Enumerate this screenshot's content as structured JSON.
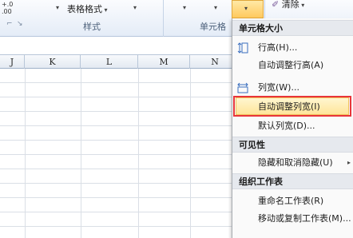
{
  "ribbon": {
    "number_format_fragment": "+.0\n.00→.0",
    "table_format_label": "表格格式",
    "styles_group_label": "样式",
    "cells_group_label": "单元格",
    "clear_label": "清除"
  },
  "columns": [
    "J",
    "K",
    "L",
    "M",
    "N"
  ],
  "menu": {
    "section_cell_size": "单元格大小",
    "row_height": "行高(H)...",
    "autofit_row_height": "自动调整行高(A)",
    "column_width": "列宽(W)...",
    "autofit_column_width": "自动调整列宽(I)",
    "default_width": "默认列宽(D)...",
    "section_visibility": "可见性",
    "hide_unhide": "隐藏和取消隐藏(U)",
    "section_organize": "组织工作表",
    "rename_sheet": "重命名工作表(R)",
    "move_copy_sheet": "移动或复制工作表(M)..."
  },
  "icons": {
    "row_height": "row-height-icon",
    "column_width": "column-width-icon",
    "clear": "eraser-icon"
  }
}
